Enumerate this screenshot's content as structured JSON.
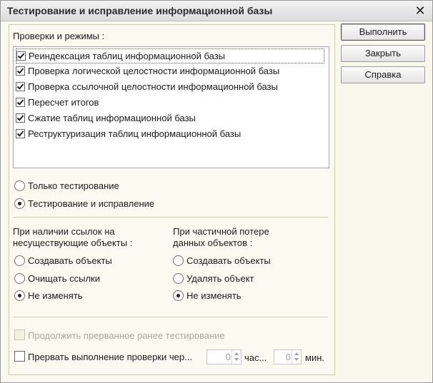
{
  "window": {
    "title": "Тестирование и исправление информационной базы"
  },
  "checks": {
    "label": "Проверки и режимы :",
    "items": [
      {
        "label": "Реиндексация таблиц информационной базы",
        "checked": true
      },
      {
        "label": "Проверка логической целостности информационной базы",
        "checked": true
      },
      {
        "label": "Проверка ссылочной целостности информационной базы",
        "checked": true
      },
      {
        "label": "Пересчет итогов",
        "checked": true
      },
      {
        "label": "Сжатие таблиц информационной базы",
        "checked": true
      },
      {
        "label": "Реструктуризация таблиц информационной базы",
        "checked": true
      }
    ]
  },
  "mode": {
    "options": [
      "Только тестирование",
      "Тестирование и исправление"
    ],
    "selected": 1
  },
  "missing_refs": {
    "label_line1": "При наличии ссылок на",
    "label_line2": "несуществующие объекты :",
    "options": [
      "Создавать объекты",
      "Очищать ссылки",
      "Не изменять"
    ],
    "selected": 2
  },
  "partial_loss": {
    "label_line1": "При частичной потере",
    "label_line2": "данных объектов :",
    "options": [
      "Создавать объекты",
      "Удалять объект",
      "Не изменять"
    ],
    "selected": 2
  },
  "continue_test": {
    "label": "Продолжить прерванное ранее тестирование",
    "enabled": false
  },
  "interrupt": {
    "label": "Прервать выполнение проверки чер...",
    "hours_value": "0",
    "hours_label": "час...",
    "minutes_value": "0",
    "minutes_label": "мин."
  },
  "buttons": {
    "run": "Выполнить",
    "close": "Закрыть",
    "help": "Справка"
  }
}
